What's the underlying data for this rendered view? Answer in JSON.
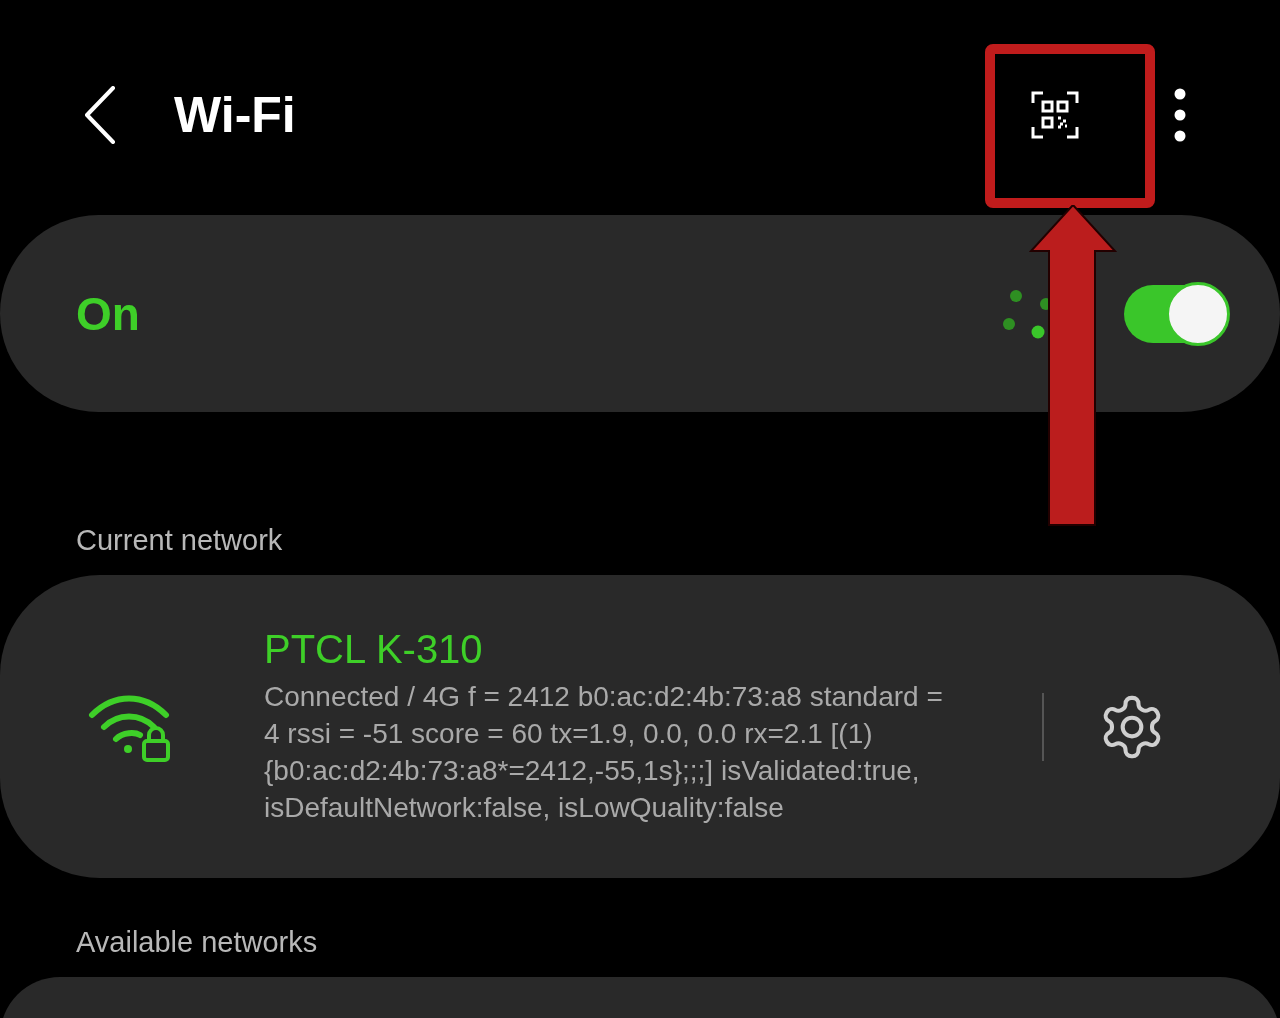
{
  "header": {
    "title": "Wi-Fi"
  },
  "wifi_toggle": {
    "label": "On",
    "on": true
  },
  "current_network": {
    "heading": "Current network",
    "name": "PTCL K-310",
    "details": "Connected / 4G f = 2412 b0:ac:d2:4b:73:a8 standard = 4 rssi = -51 score = 60  tx=1.9, 0.0, 0.0  rx=2.1 [(1) {b0:ac:d2:4b:73:a8*=2412,-55,1s};;;] isValidated:true, isDefaultNetwork:false, isLowQuality:false",
    "secured": true
  },
  "available_networks": {
    "heading": "Available networks"
  }
}
